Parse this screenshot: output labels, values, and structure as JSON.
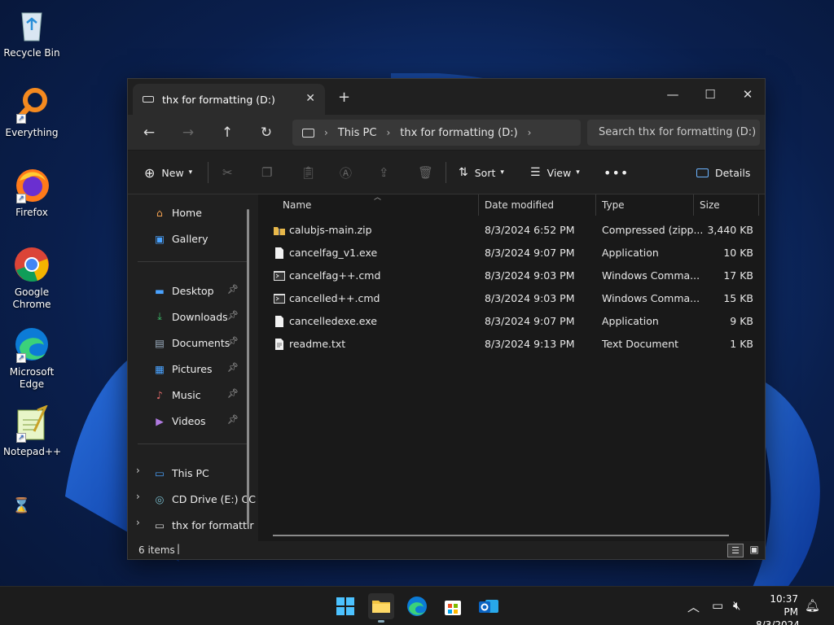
{
  "desktop": {
    "icons": [
      {
        "label": "Recycle Bin",
        "icon": "recycle-bin-icon"
      },
      {
        "label": "Everything",
        "icon": "everything-search-icon"
      },
      {
        "label": "Firefox",
        "icon": "firefox-icon"
      },
      {
        "label": "Google Chrome",
        "icon": "chrome-icon"
      },
      {
        "label": "Microsoft Edge",
        "icon": "edge-icon"
      },
      {
        "label": "Notepad++",
        "icon": "notepad-plus-plus-icon"
      }
    ]
  },
  "window": {
    "tab_title": "thx for formatting (D:)",
    "breadcrumb": [
      "This PC",
      "thx for formatting (D:)"
    ],
    "search_placeholder": "Search thx for formatting (D:)",
    "commands": {
      "new": "New",
      "sort": "Sort",
      "view": "View",
      "details": "Details"
    }
  },
  "nav": {
    "quick": [
      {
        "label": "Home",
        "icon": "home-icon"
      },
      {
        "label": "Gallery",
        "icon": "gallery-icon"
      }
    ],
    "pinned": [
      {
        "label": "Desktop",
        "icon": "desktop-folder-icon"
      },
      {
        "label": "Downloads",
        "icon": "downloads-folder-icon"
      },
      {
        "label": "Documents",
        "icon": "documents-folder-icon"
      },
      {
        "label": "Pictures",
        "icon": "pictures-folder-icon"
      },
      {
        "label": "Music",
        "icon": "music-folder-icon"
      },
      {
        "label": "Videos",
        "icon": "videos-folder-icon"
      }
    ],
    "drives": [
      {
        "label": "This PC",
        "icon": "this-pc-icon"
      },
      {
        "label": "CD Drive (E:) CC",
        "icon": "cd-drive-icon"
      },
      {
        "label": "thx for formattir",
        "icon": "drive-icon"
      }
    ]
  },
  "files": {
    "columns": [
      "Name",
      "Date modified",
      "Type",
      "Size"
    ],
    "rows": [
      {
        "name": "calubjs-main.zip",
        "date": "8/3/2024 6:52 PM",
        "type": "Compressed (zipp...",
        "size": "3,440 KB",
        "icon": "zip-folder-icon"
      },
      {
        "name": "cancelfag_v1.exe",
        "date": "8/3/2024 9:07 PM",
        "type": "Application",
        "size": "10 KB",
        "icon": "exe-file-icon"
      },
      {
        "name": "cancelfag++.cmd",
        "date": "8/3/2024 9:03 PM",
        "type": "Windows Comma...",
        "size": "17 KB",
        "icon": "cmd-file-icon"
      },
      {
        "name": "cancelled++.cmd",
        "date": "8/3/2024 9:03 PM",
        "type": "Windows Comma...",
        "size": "15 KB",
        "icon": "cmd-file-icon"
      },
      {
        "name": "cancelledexe.exe",
        "date": "8/3/2024 9:07 PM",
        "type": "Application",
        "size": "9 KB",
        "icon": "exe-file-icon"
      },
      {
        "name": "readme.txt",
        "date": "8/3/2024 9:13 PM",
        "type": "Text Document",
        "size": "1 KB",
        "icon": "text-file-icon"
      }
    ]
  },
  "status": {
    "count": "6 items"
  },
  "taskbar": {
    "time": "10:37 PM",
    "date": "8/3/2024",
    "pinned": [
      "start-icon",
      "file-explorer-icon",
      "edge-icon",
      "store-icon",
      "outlook-icon"
    ]
  }
}
